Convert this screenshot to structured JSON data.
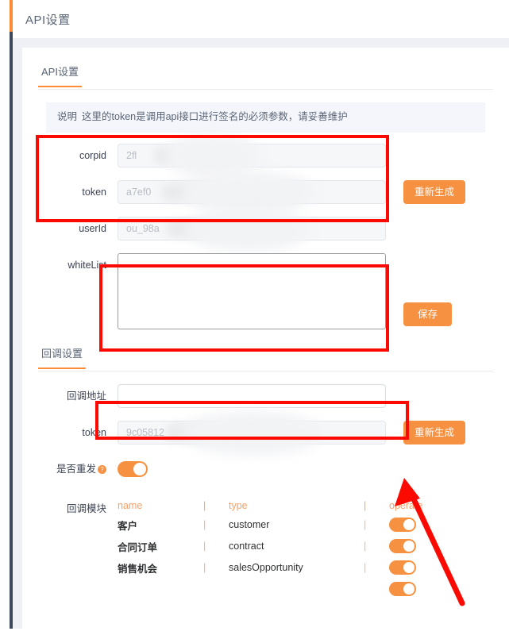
{
  "page": {
    "title": "API设置"
  },
  "api_tab": {
    "label": "API设置",
    "banner_label": "说明",
    "banner_text": "这里的token是调用api接口进行签名的必须参数，请妥善维护",
    "fields": [
      {
        "label": "corpid",
        "value": "2fl                    5f",
        "placeholder": ""
      },
      {
        "label": "token",
        "value": "a7ef0                           e37b9",
        "placeholder": ""
      },
      {
        "label": "userId",
        "value": "ou_98a                      efdfd5da7",
        "placeholder": ""
      },
      {
        "label": "whiteList",
        "value": "",
        "placeholder": ""
      }
    ],
    "regenerate_button": "重新生成",
    "save_button": "保存"
  },
  "callback_tab": {
    "label": "回调设置",
    "address_label": "回调地址",
    "address_value": "",
    "token_label": "token",
    "token_value": "9c05812                                 6",
    "regenerate_button": "重新生成",
    "resend_label": "是否重发",
    "resend_help_icon": "question-icon",
    "resend_on": true,
    "modules_label": "回调模块",
    "table": {
      "columns": [
        "name",
        "type",
        "operate"
      ],
      "separator": "|",
      "rows": [
        {
          "name": "客户",
          "type": "customer",
          "enabled": true
        },
        {
          "name": "合同订单",
          "type": "contract",
          "enabled": true
        },
        {
          "name": "销售机会",
          "type": "salesOpportunity",
          "enabled": true
        },
        {
          "name": "",
          "type": "",
          "enabled": true
        }
      ]
    }
  },
  "colors": {
    "accent": "#f79142",
    "rail_top": "#ff8c37",
    "rail": "#3d4a5c",
    "annotation": "#fa0a00",
    "table_header": "#f9a066"
  }
}
